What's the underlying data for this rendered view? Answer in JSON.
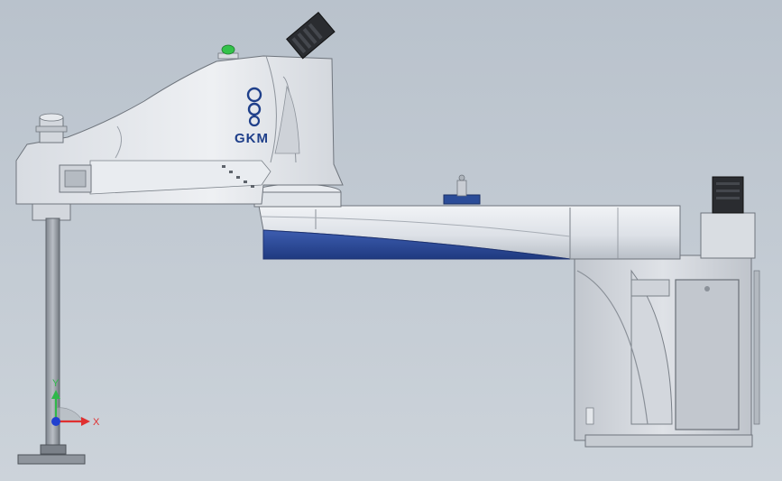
{
  "model": {
    "brand_logo_text": "GKM",
    "colors": {
      "background_top": "#b9c2cc",
      "background_bottom": "#ccd3da",
      "body_light": "#e6e9ee",
      "body_mid": "#c9cdd4",
      "body_shadow": "#9ea5ae",
      "accent_blue": "#2d4b95",
      "logo_blue": "#1f3f8a",
      "status_lamp": "#33c24a",
      "cable_connector": "#2a2c30"
    }
  },
  "triad": {
    "x_label": "X",
    "y_label": "Y",
    "x_color": "#e03030",
    "y_color": "#2fb84a",
    "z_color": "#2040d0"
  }
}
